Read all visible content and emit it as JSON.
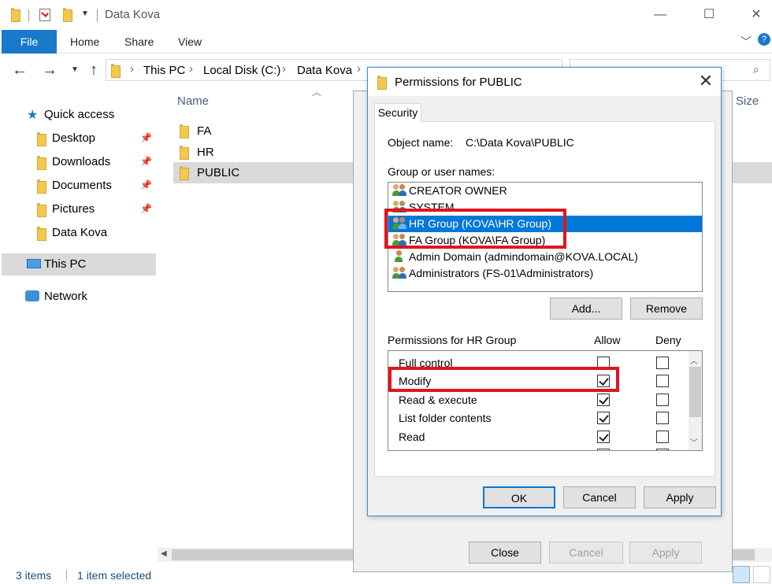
{
  "explorer": {
    "window_title": "Data Kova",
    "ribbon_tabs": {
      "file": "File",
      "home": "Home",
      "share": "Share",
      "view": "View"
    },
    "breadcrumb": [
      "This PC",
      "Local Disk (C:)",
      "Data Kova"
    ],
    "nav_pane": {
      "quick_access": "Quick access",
      "items": [
        {
          "label": "Desktop",
          "pinned": true
        },
        {
          "label": "Downloads",
          "pinned": true
        },
        {
          "label": "Documents",
          "pinned": true
        },
        {
          "label": "Pictures",
          "pinned": true
        },
        {
          "label": "Data Kova",
          "pinned": false
        }
      ],
      "this_pc": "This PC",
      "network": "Network"
    },
    "columns": {
      "name": "Name",
      "size": "Size"
    },
    "files": [
      "FA",
      "HR",
      "PUBLIC"
    ],
    "selected_file": "PUBLIC",
    "status": {
      "item_count": "3 items",
      "selection": "1 item selected"
    }
  },
  "properties_dialog": {
    "buttons": {
      "close": "Close",
      "cancel": "Cancel",
      "apply": "Apply"
    }
  },
  "permissions_dialog": {
    "title": "Permissions for PUBLIC",
    "tab": "Security",
    "object_name_label": "Object name:",
    "object_name_value": "C:\\Data Kova\\PUBLIC",
    "group_label": "Group or user names:",
    "users": [
      {
        "label": "CREATOR OWNER",
        "type": "group"
      },
      {
        "label": "SYSTEM",
        "type": "group"
      },
      {
        "label": "HR Group (KOVA\\HR Group)",
        "type": "group",
        "selected": true
      },
      {
        "label": "FA Group (KOVA\\FA Group)",
        "type": "group"
      },
      {
        "label": "Admin Domain (admindomain@KOVA.LOCAL)",
        "type": "user"
      },
      {
        "label": "Administrators (FS-01\\Administrators)",
        "type": "group"
      }
    ],
    "add_button": "Add...",
    "remove_button": "Remove",
    "permissions_label": "Permissions for HR Group",
    "allow_header": "Allow",
    "deny_header": "Deny",
    "permissions": [
      {
        "label": "Full control",
        "allow": false,
        "deny": false
      },
      {
        "label": "Modify",
        "allow": true,
        "deny": false
      },
      {
        "label": "Read & execute",
        "allow": true,
        "deny": false
      },
      {
        "label": "List folder contents",
        "allow": true,
        "deny": false
      },
      {
        "label": "Read",
        "allow": true,
        "deny": false
      }
    ],
    "ok_button": "OK",
    "cancel_button": "Cancel",
    "apply_button": "Apply"
  },
  "colors": {
    "accent": "#0078d7",
    "file_tab": "#1979ca",
    "highlight": "#e0141e"
  }
}
